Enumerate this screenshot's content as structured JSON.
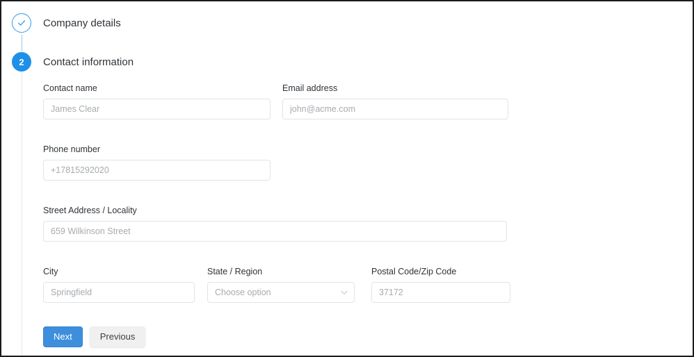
{
  "steps": [
    {
      "label": "Company details",
      "state": "completed",
      "marker": "check-icon"
    },
    {
      "label": "Contact information",
      "state": "current",
      "marker": "2"
    }
  ],
  "form": {
    "contact_name": {
      "label": "Contact name",
      "placeholder": "James Clear",
      "value": ""
    },
    "email": {
      "label": "Email address",
      "placeholder": "john@acme.com",
      "value": ""
    },
    "phone": {
      "label": "Phone number",
      "placeholder": "+17815292020",
      "value": ""
    },
    "street": {
      "label": "Street Address / Locality",
      "placeholder": "659 Wilkinson Street",
      "value": ""
    },
    "city": {
      "label": "City",
      "placeholder": "Springfield",
      "value": ""
    },
    "state": {
      "label": "State / Region",
      "placeholder": "Choose option",
      "value": ""
    },
    "postal": {
      "label": "Postal Code/Zip Code",
      "placeholder": "37172",
      "value": ""
    }
  },
  "buttons": {
    "next": "Next",
    "previous": "Previous"
  },
  "colors": {
    "accent_blue": "#1e90e8",
    "step_outline_blue": "#2f98f0",
    "next_button_blue": "#3d8fdd",
    "previous_button_gray": "#f0f0f0",
    "input_border": "#e2e3e5",
    "placeholder_text": "#a7abaf",
    "label_text": "#2e3338"
  }
}
